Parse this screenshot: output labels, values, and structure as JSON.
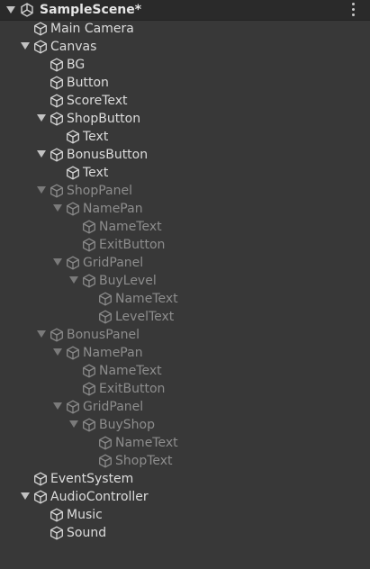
{
  "window": {
    "scene_name": "SampleScene*"
  },
  "icons": {
    "scene": "unity-logo-icon",
    "object": "cube-icon",
    "menu": "kebab-menu-icon"
  },
  "colors": {
    "background": "#383838",
    "header": "#2a2a2a",
    "active_text": "#dcdcdc",
    "inactive_text": "#8d8d8d"
  },
  "hierarchy": [
    {
      "label": "Main Camera",
      "depth": 1,
      "expandable": false,
      "active": true
    },
    {
      "label": "Canvas",
      "depth": 1,
      "expandable": true,
      "active": true
    },
    {
      "label": "BG",
      "depth": 2,
      "expandable": false,
      "active": true
    },
    {
      "label": "Button",
      "depth": 2,
      "expandable": false,
      "active": true
    },
    {
      "label": "ScoreText",
      "depth": 2,
      "expandable": false,
      "active": true
    },
    {
      "label": "ShopButton",
      "depth": 2,
      "expandable": true,
      "active": true
    },
    {
      "label": "Text",
      "depth": 3,
      "expandable": false,
      "active": true
    },
    {
      "label": "BonusButton",
      "depth": 2,
      "expandable": true,
      "active": true
    },
    {
      "label": "Text",
      "depth": 3,
      "expandable": false,
      "active": true
    },
    {
      "label": "ShopPanel",
      "depth": 2,
      "expandable": true,
      "active": false
    },
    {
      "label": "NamePan",
      "depth": 3,
      "expandable": true,
      "active": false
    },
    {
      "label": "NameText",
      "depth": 4,
      "expandable": false,
      "active": false
    },
    {
      "label": "ExitButton",
      "depth": 4,
      "expandable": false,
      "active": false
    },
    {
      "label": "GridPanel",
      "depth": 3,
      "expandable": true,
      "active": false
    },
    {
      "label": "BuyLevel",
      "depth": 4,
      "expandable": true,
      "active": false
    },
    {
      "label": "NameText",
      "depth": 5,
      "expandable": false,
      "active": false
    },
    {
      "label": "LevelText",
      "depth": 5,
      "expandable": false,
      "active": false
    },
    {
      "label": "BonusPanel",
      "depth": 2,
      "expandable": true,
      "active": false
    },
    {
      "label": "NamePan",
      "depth": 3,
      "expandable": true,
      "active": false
    },
    {
      "label": "NameText",
      "depth": 4,
      "expandable": false,
      "active": false
    },
    {
      "label": "ExitButton",
      "depth": 4,
      "expandable": false,
      "active": false
    },
    {
      "label": "GridPanel",
      "depth": 3,
      "expandable": true,
      "active": false
    },
    {
      "label": "BuyShop",
      "depth": 4,
      "expandable": true,
      "active": false
    },
    {
      "label": "NameText",
      "depth": 5,
      "expandable": false,
      "active": false
    },
    {
      "label": "ShopText",
      "depth": 5,
      "expandable": false,
      "active": false
    },
    {
      "label": "EventSystem",
      "depth": 1,
      "expandable": false,
      "active": true
    },
    {
      "label": "AudioController",
      "depth": 1,
      "expandable": true,
      "active": true
    },
    {
      "label": "Music",
      "depth": 2,
      "expandable": false,
      "active": true
    },
    {
      "label": "Sound",
      "depth": 2,
      "expandable": false,
      "active": true
    }
  ]
}
